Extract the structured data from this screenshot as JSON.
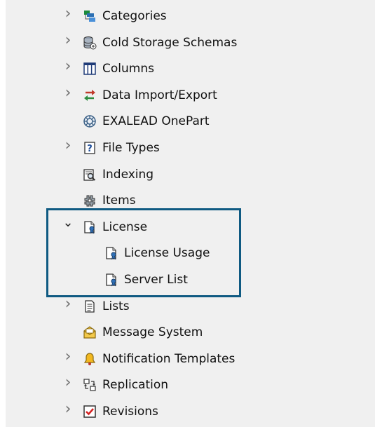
{
  "tree": {
    "items": [
      {
        "label": "Categories",
        "icon": "categories-icon",
        "expandable": true,
        "expanded": false,
        "level": 0
      },
      {
        "label": "Cold Storage Schemas",
        "icon": "database-icon",
        "expandable": true,
        "expanded": false,
        "level": 0
      },
      {
        "label": "Columns",
        "icon": "columns-icon",
        "expandable": true,
        "expanded": false,
        "level": 0
      },
      {
        "label": "Data Import/Export",
        "icon": "import-export-icon",
        "expandable": true,
        "expanded": false,
        "level": 0
      },
      {
        "label": "EXALEAD OnePart",
        "icon": "exalead-icon",
        "expandable": false,
        "expanded": false,
        "level": 0
      },
      {
        "label": "File Types",
        "icon": "file-types-icon",
        "expandable": true,
        "expanded": false,
        "level": 0
      },
      {
        "label": "Indexing",
        "icon": "indexing-icon",
        "expandable": false,
        "expanded": false,
        "level": 0
      },
      {
        "label": "Items",
        "icon": "items-icon",
        "expandable": false,
        "expanded": false,
        "level": 0
      },
      {
        "label": "License",
        "icon": "license-icon",
        "expandable": true,
        "expanded": true,
        "level": 0
      },
      {
        "label": "License Usage",
        "icon": "license-icon",
        "expandable": false,
        "expanded": false,
        "level": 1
      },
      {
        "label": "Server List",
        "icon": "license-icon",
        "expandable": false,
        "expanded": false,
        "level": 1
      },
      {
        "label": "Lists",
        "icon": "lists-icon",
        "expandable": true,
        "expanded": false,
        "level": 0
      },
      {
        "label": "Message System",
        "icon": "message-system-icon",
        "expandable": false,
        "expanded": false,
        "level": 0
      },
      {
        "label": "Notification Templates",
        "icon": "bell-icon",
        "expandable": true,
        "expanded": false,
        "level": 0
      },
      {
        "label": "Replication",
        "icon": "replication-icon",
        "expandable": true,
        "expanded": false,
        "level": 0
      },
      {
        "label": "Revisions",
        "icon": "checkbox-icon",
        "expandable": true,
        "expanded": false,
        "level": 0
      }
    ]
  },
  "colors": {
    "highlight_border": "#0f5a82",
    "panel_background": "#f0f0f0"
  }
}
